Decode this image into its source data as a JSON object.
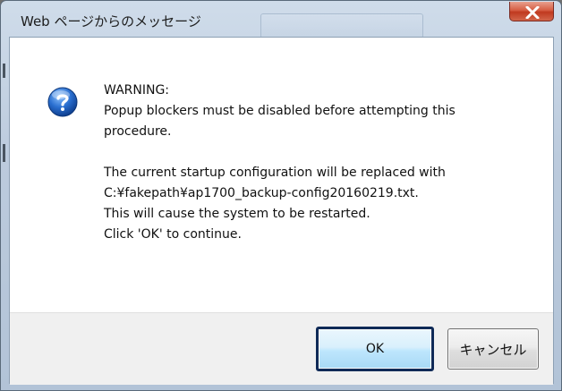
{
  "window": {
    "title": "Web ページからのメッセージ",
    "close_icon": "close-icon"
  },
  "dialog": {
    "icon": "question-icon",
    "icon_color": "#1f5fb4",
    "lines": [
      "WARNING:",
      "Popup blockers must be disabled before attempting this",
      "procedure.",
      "The current startup configuration will be replaced with",
      "C:¥fakepath¥ap1700_backup-config20160219.txt.",
      "This will cause the system to be restarted.",
      "Click 'OK' to continue."
    ]
  },
  "buttons": {
    "ok_label": "OK",
    "cancel_label": "キャンセル"
  },
  "colors": {
    "close_button": "#c0391f",
    "ok_focus_border": "#0f2a57"
  }
}
